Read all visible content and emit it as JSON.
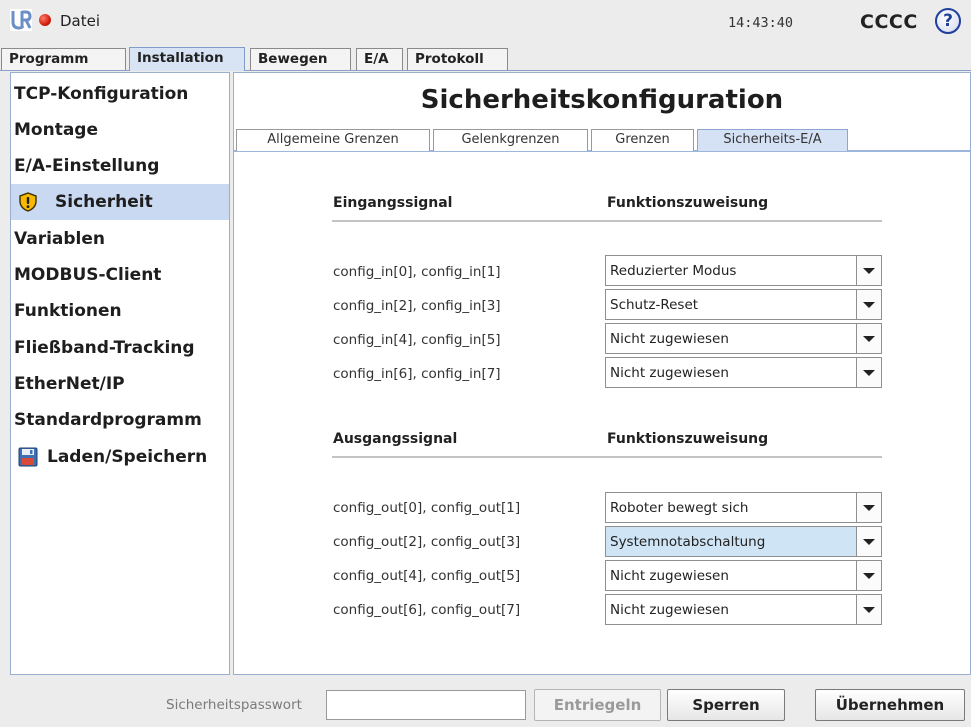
{
  "topbar": {
    "file_menu": "Datei",
    "clock": "14:43:40",
    "robot_name": "CCCC",
    "help_glyph": "?"
  },
  "main_tabs": [
    "Programm",
    "Installation",
    "Bewegen",
    "E/A",
    "Protokoll"
  ],
  "active_main_tab": "Installation",
  "sidebar": {
    "items": [
      {
        "label": "TCP-Konfiguration"
      },
      {
        "label": "Montage"
      },
      {
        "label": "E/A-Einstellung"
      },
      {
        "label": "Sicherheit",
        "icon": "shield-warning-icon",
        "selected": true
      },
      {
        "label": "Variablen"
      },
      {
        "label": "MODBUS-Client"
      },
      {
        "label": "Funktionen"
      },
      {
        "label": "Fließband-Tracking"
      },
      {
        "label": "EtherNet/IP"
      },
      {
        "label": "Standardprogramm"
      },
      {
        "label": "Laden/Speichern",
        "icon": "floppy-disk-icon"
      }
    ]
  },
  "content": {
    "title": "Sicherheitskonfiguration",
    "sub_tabs": [
      "Allgemeine Grenzen",
      "Gelenkgrenzen",
      "Grenzen",
      "Sicherheits-E/A"
    ],
    "active_sub_tab": "Sicherheits-E/A",
    "inputs": {
      "col_signal": "Eingangssignal",
      "col_function": "Funktionszuweisung",
      "rows": [
        {
          "signal": "config_in[0], config_in[1]",
          "function": "Reduzierter Modus"
        },
        {
          "signal": "config_in[2], config_in[3]",
          "function": "Schutz-Reset"
        },
        {
          "signal": "config_in[4], config_in[5]",
          "function": "Nicht zugewiesen"
        },
        {
          "signal": "config_in[6], config_in[7]",
          "function": "Nicht zugewiesen"
        }
      ]
    },
    "outputs": {
      "col_signal": "Ausgangssignal",
      "col_function": "Funktionszuweisung",
      "rows": [
        {
          "signal": "config_out[0], config_out[1]",
          "function": "Roboter bewegt sich"
        },
        {
          "signal": "config_out[2], config_out[3]",
          "function": "Systemnotabschaltung"
        },
        {
          "signal": "config_out[4], config_out[5]",
          "function": "Nicht zugewiesen"
        },
        {
          "signal": "config_out[6], config_out[7]",
          "function": "Nicht zugewiesen"
        }
      ]
    }
  },
  "bottombar": {
    "password_label": "Sicherheitspasswort",
    "password_value": "",
    "unlock_label": "Entriegeln",
    "lock_label": "Sperren",
    "apply_label": "Übernehmen"
  },
  "colors": {
    "selection": "#c9d9f1",
    "highlight_dropdown": "#cfe4f5",
    "stop_red": "#d21d0c",
    "help_blue": "#1f3f9a"
  }
}
